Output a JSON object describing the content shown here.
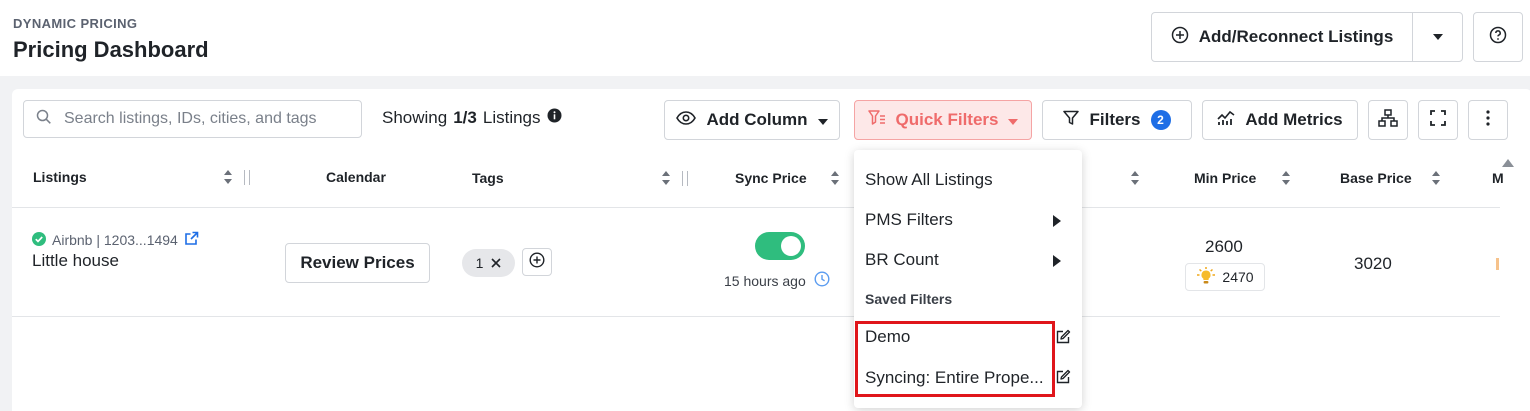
{
  "header": {
    "eyebrow": "DYNAMIC PRICING",
    "title": "Pricing Dashboard",
    "add_listings_label": "Add/Reconnect Listings"
  },
  "toolbar": {
    "search_placeholder": "Search listings, IDs, cities, and tags",
    "showing_prefix": "Showing",
    "showing_count": "1/3",
    "showing_suffix": "Listings",
    "add_column_label": "Add Column",
    "quick_filters_label": "Quick Filters",
    "filters_label": "Filters",
    "filters_count": "2",
    "add_metrics_label": "Add Metrics"
  },
  "columns": {
    "listings": "Listings",
    "calendar": "Calendar",
    "tags": "Tags",
    "sync_price": "Sync Price",
    "min_price": "Min Price",
    "base_price": "Base Price",
    "clipped_next": "M"
  },
  "row": {
    "source": "Airbnb | 1203...1494",
    "name": "Little house",
    "review_label": "Review Prices",
    "tag_count": "1",
    "sync_enabled": true,
    "sync_time": "15 hours ago",
    "min_price": "2600",
    "recommended_min": "2470",
    "base_price": "3020"
  },
  "quick_filters_menu": {
    "show_all": "Show All Listings",
    "pms_filters": "PMS Filters",
    "br_count": "BR Count",
    "saved_section": "Saved Filters",
    "saved": [
      "Demo",
      "Syncing: Entire Prope..."
    ]
  },
  "colors": {
    "accent_blue": "#1e6ee6",
    "quick_filter_red": "#ef6b6b",
    "toggle_green": "#2fbd7e",
    "highlight_red": "#e0161b"
  }
}
